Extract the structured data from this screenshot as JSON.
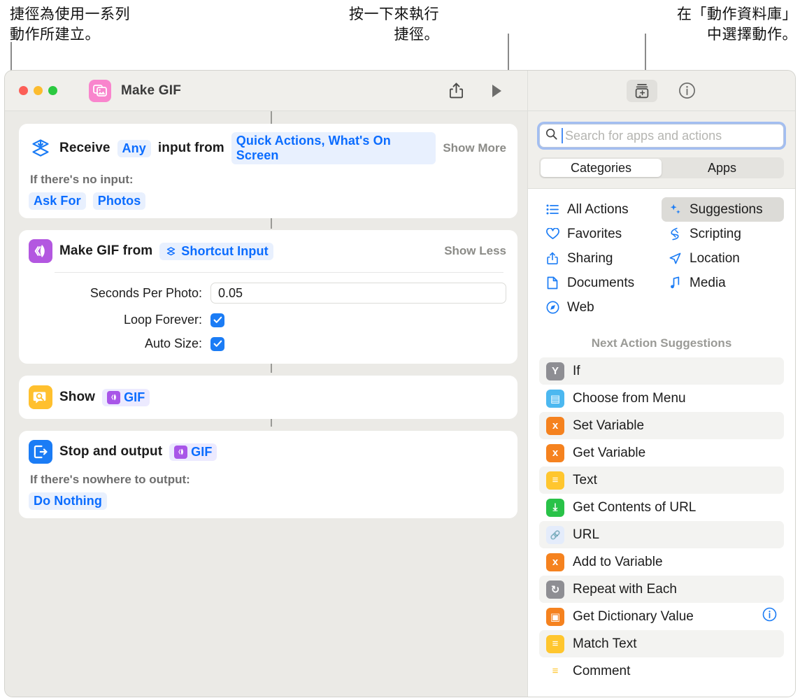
{
  "callouts": {
    "left": "捷徑為使用一系列\n動作所建立。",
    "middle": "按一下來執行\n捷徑。",
    "right": "在「動作資料庫」\n中選擇動作。"
  },
  "window": {
    "title": "Make GIF",
    "app_icon": "photos-icon",
    "traffic_lights": [
      "close-button",
      "minimize-button",
      "zoom-button"
    ],
    "toolbar": {
      "share_icon": "share-icon",
      "run_icon": "play-icon",
      "library_icon": "action-library-icon",
      "info_icon": "info-icon"
    }
  },
  "editor": {
    "actions": [
      {
        "icon": "receive-input-icon",
        "icon_style": "plain",
        "title": "Receive",
        "token1": "Any",
        "middle_text": "input from",
        "token2": "Quick Actions, What's On Screen",
        "toggle": "Show More",
        "sub_label": "If there's no input:",
        "sub_tokens": [
          "Ask For",
          "Photos"
        ]
      },
      {
        "icon": "make-gif-icon",
        "icon_style": "purple",
        "title": "Make GIF from",
        "token_glyph": "shortcut-input-glyph",
        "token1": "Shortcut Input",
        "toggle": "Show Less",
        "fields": [
          {
            "label": "Seconds Per Photo:",
            "type": "text",
            "value": "0.05"
          },
          {
            "label": "Loop Forever:",
            "type": "checkbox",
            "checked": true
          },
          {
            "label": "Auto Size:",
            "type": "checkbox",
            "checked": true
          }
        ]
      },
      {
        "icon": "show-result-icon",
        "icon_style": "yellow",
        "title": "Show",
        "token_glyph": "gif-variable-glyph",
        "token1": "GIF"
      },
      {
        "icon": "stop-output-icon",
        "icon_style": "blue",
        "title": "Stop and output",
        "token_glyph": "gif-variable-glyph",
        "token1": "GIF",
        "sub_label": "If there's nowhere to output:",
        "sub_tokens": [
          "Do Nothing"
        ]
      }
    ]
  },
  "sidebar": {
    "search": {
      "placeholder": "Search for apps and actions",
      "value": "",
      "icon": "search-icon"
    },
    "segments": [
      {
        "label": "Categories",
        "selected": true
      },
      {
        "label": "Apps",
        "selected": false
      }
    ],
    "categories_left": [
      {
        "label": "All Actions",
        "icon": "list-icon",
        "selected": false
      },
      {
        "label": "Favorites",
        "icon": "heart-icon",
        "selected": false
      },
      {
        "label": "Sharing",
        "icon": "share-icon",
        "selected": false
      },
      {
        "label": "Documents",
        "icon": "document-icon",
        "selected": false
      },
      {
        "label": "Web",
        "icon": "safari-icon",
        "selected": false
      }
    ],
    "categories_right": [
      {
        "label": "Suggestions",
        "icon": "sparkles-icon",
        "selected": true
      },
      {
        "label": "Scripting",
        "icon": "scripting-icon",
        "selected": false
      },
      {
        "label": "Location",
        "icon": "location-icon",
        "selected": false
      },
      {
        "label": "Media",
        "icon": "music-note-icon",
        "selected": false
      }
    ],
    "suggestions_title": "Next Action Suggestions",
    "suggestions": [
      {
        "label": "If",
        "icon": "if-icon",
        "color": "#8e8e93",
        "glyph": "Y",
        "info": false
      },
      {
        "label": "Choose from Menu",
        "icon": "menu-icon",
        "color": "#4cb8f0",
        "glyph": "▤",
        "info": false
      },
      {
        "label": "Set Variable",
        "icon": "variable-icon",
        "color": "#f5821f",
        "glyph": "x",
        "info": false
      },
      {
        "label": "Get Variable",
        "icon": "variable-icon",
        "color": "#f5821f",
        "glyph": "x",
        "info": false
      },
      {
        "label": "Text",
        "icon": "text-icon",
        "color": "#ffc62e",
        "glyph": "≡",
        "info": false
      },
      {
        "label": "Get Contents of URL",
        "icon": "download-icon",
        "color": "#29c248",
        "glyph": "⤓",
        "info": false
      },
      {
        "label": "URL",
        "icon": "link-icon",
        "color": "#e4ecfb",
        "glyph": "🔗",
        "info": false
      },
      {
        "label": "Add to Variable",
        "icon": "variable-icon",
        "color": "#f5821f",
        "glyph": "x",
        "info": false
      },
      {
        "label": "Repeat with Each",
        "icon": "repeat-icon",
        "color": "#8e8e93",
        "glyph": "↻",
        "info": false
      },
      {
        "label": "Get Dictionary Value",
        "icon": "dictionary-icon",
        "color": "#f5821f",
        "glyph": "▣",
        "info": true
      },
      {
        "label": "Match Text",
        "icon": "text-icon",
        "color": "#ffc62e",
        "glyph": "≡",
        "info": false
      },
      {
        "label": "Comment",
        "icon": "comment-icon",
        "color": "#ffffff",
        "glyph": "≡",
        "info": false
      }
    ]
  },
  "colors": {
    "accent_blue": "#0a6cff",
    "purple": "#b357e0",
    "yellow": "#ffc02e",
    "blue": "#1b7cf5",
    "pink": "#f985cd"
  }
}
